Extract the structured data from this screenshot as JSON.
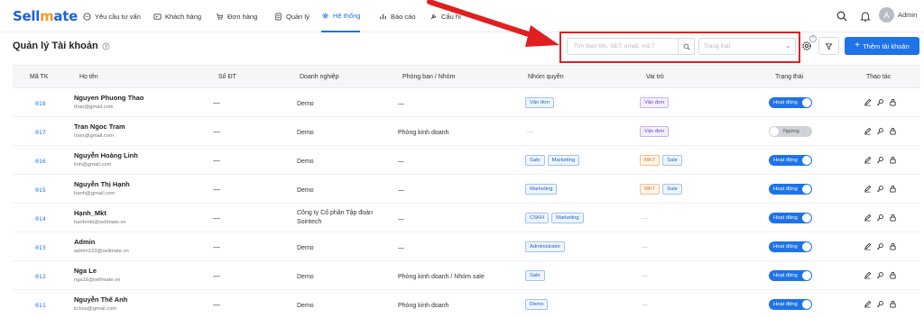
{
  "app": {
    "logo_prefix": "Sell",
    "logo_m": "m",
    "logo_suffix": "ate"
  },
  "nav": {
    "items": [
      {
        "label": "Yêu cầu tư vấn",
        "icon": "chat-icon"
      },
      {
        "label": "Khách hàng",
        "icon": "contact-card-icon"
      },
      {
        "label": "Đơn hàng",
        "icon": "cart-icon"
      },
      {
        "label": "Quản lý",
        "icon": "document-icon"
      },
      {
        "label": "Hệ thống",
        "icon": "gear-icon"
      },
      {
        "label": "Báo cáo",
        "icon": "bar-chart-icon"
      },
      {
        "label": "Cấu hì",
        "icon": "wrench-icon"
      }
    ],
    "active": "Hệ thống"
  },
  "user": {
    "avatar_letter": "A",
    "name": "Admin"
  },
  "page": {
    "title": "Quản lý Tài khoản"
  },
  "toolbar": {
    "search_placeholder": "Tìm theo tên, SĐT, email, mã T",
    "status_placeholder": "Trạng thái",
    "gear_badge": "?",
    "add_label": "Thêm tài khoản"
  },
  "table": {
    "headers": [
      "Mã TK",
      "Họ tên",
      "Số ĐT",
      "Doanh nghiệp",
      "Phòng ban / Nhóm",
      "Nhóm quyền",
      "Vai trò",
      "Trạng thái",
      "Thao tác"
    ],
    "rows": [
      {
        "id": "018",
        "name": "Nguyen Phuong Thao",
        "email": "thao@gmail.com",
        "phone": "—",
        "biz": "Demo",
        "dept": "—",
        "perms": [
          "Vận đơn"
        ],
        "roles": [
          "Vận đơn"
        ],
        "status": "Hoạt động"
      },
      {
        "id": "017",
        "name": "Tran Ngoc Tram",
        "email": "tram@gmail.com",
        "phone": "—",
        "biz": "Demo",
        "dept": "Phòng kinh doanh",
        "perms_empty": "—",
        "roles": [
          "Vận đơn"
        ],
        "status": "Ngừng"
      },
      {
        "id": "016",
        "name": "Nguyễn Hoàng Linh",
        "email": "linh@gmail.com",
        "phone": "—",
        "biz": "Demo",
        "dept": "—",
        "perms": [
          "Sale",
          "Marketing"
        ],
        "roles": [
          "MKT",
          "Sale"
        ],
        "status": "Hoạt động"
      },
      {
        "id": "015",
        "name": "Nguyễn Thị Hạnh",
        "email": "hanh@gmail.com",
        "phone": "—",
        "biz": "Demo",
        "dept": "—",
        "perms": [
          "Marketing"
        ],
        "roles": [
          "MKT",
          "Sale"
        ],
        "status": "Hoạt động"
      },
      {
        "id": "014",
        "name": "Hạnh_Mkt",
        "email": "hanhmkt@sellmate.vn",
        "phone": "—",
        "biz_line1": "Công ty Cổ phần Tập đoàn",
        "biz_line2": "Sointech",
        "dept": "—",
        "perms": [
          "CSKH",
          "Marketing"
        ],
        "roles_empty": "—",
        "status": "Hoạt động"
      },
      {
        "id": "013",
        "name": "Admin",
        "email": "admin123@sellmate.vn",
        "phone": "—",
        "biz": "Demo",
        "dept": "—",
        "perms": [
          "Administrator"
        ],
        "roles_empty": "—",
        "status": "Hoạt động"
      },
      {
        "id": "012",
        "name": "Nga Le",
        "email": "nga16@sellmate.vn",
        "phone": "—",
        "biz": "Demo",
        "dept": "Phòng kinh doanh / Nhóm sale",
        "perms": [
          "Sale"
        ],
        "roles_empty": "—",
        "status": "Hoạt động"
      },
      {
        "id": "011",
        "name": "Nguyễn Thế Anh",
        "email": "lichsu@gmail.com",
        "phone": "—",
        "biz": "Demo",
        "dept": "Phòng kinh doanh",
        "perms": [
          "Demo"
        ],
        "roles_empty": "—",
        "status": "Hoạt động"
      }
    ]
  },
  "colors": {
    "accent": "#1e73e8",
    "annotation": "#e02020"
  }
}
